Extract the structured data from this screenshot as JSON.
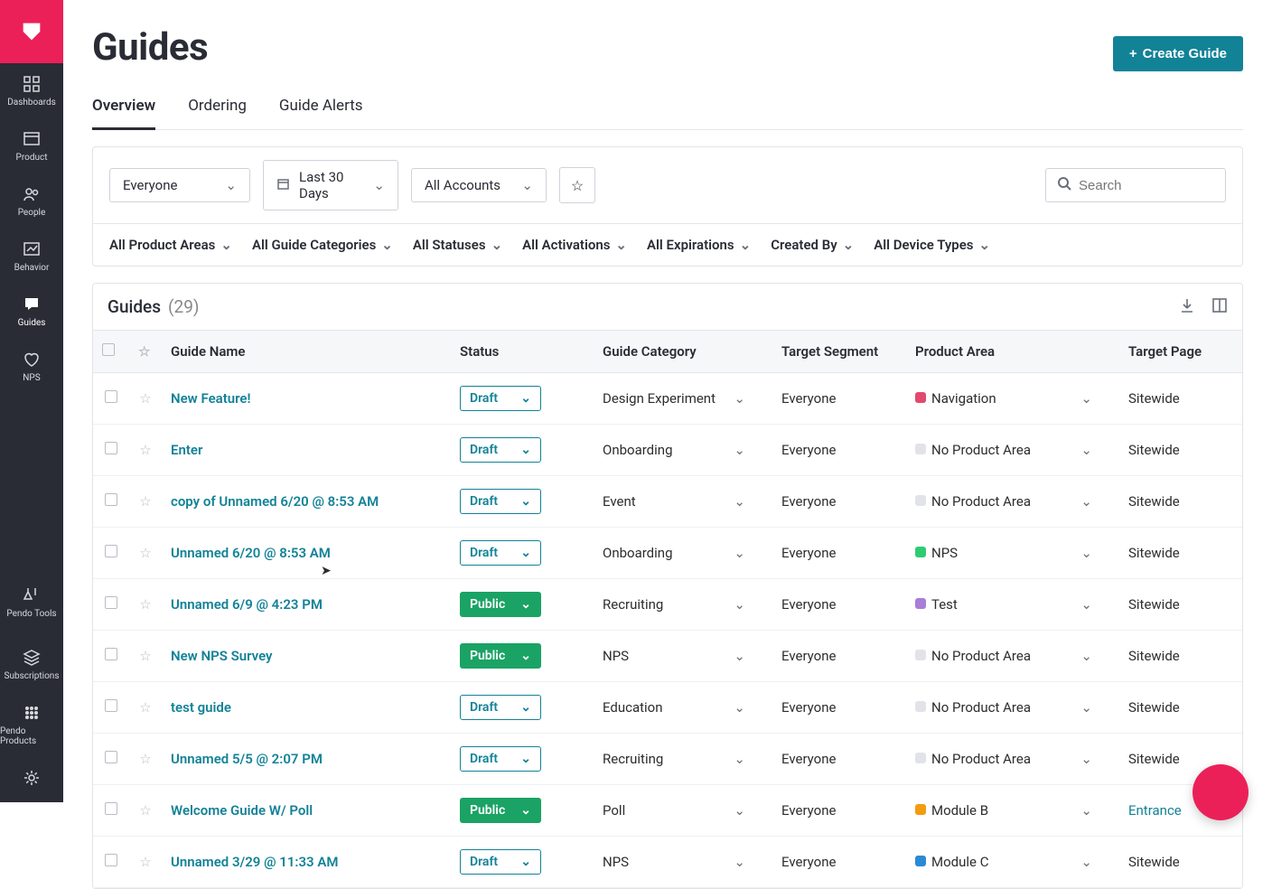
{
  "page_title": "Guides",
  "create_btn": "Create Guide",
  "tabs": [
    "Overview",
    "Ordering",
    "Guide Alerts"
  ],
  "active_tab": 0,
  "top_filters": {
    "segment": "Everyone",
    "date": "Last 30 Days",
    "accounts": "All Accounts",
    "search_placeholder": "Search"
  },
  "pill_filters": [
    "All Product Areas",
    "All Guide Categories",
    "All Statuses",
    "All Activations",
    "All Expirations",
    "Created By",
    "All Device Types"
  ],
  "table_title": "Guides",
  "table_count": "(29)",
  "columns": [
    "Guide Name",
    "Status",
    "Guide Category",
    "Target Segment",
    "Product Area",
    "Target Page"
  ],
  "sidebar": [
    "Dashboards",
    "Product",
    "People",
    "Behavior",
    "Guides",
    "NPS",
    "Pendo Tools",
    "Subscriptions",
    "Pendo Products"
  ],
  "product_area_colors": {
    "Navigation": "#e24a6d",
    "No Product Area": "#e1e3e8",
    "NPS": "#2ecc71",
    "Test": "#a97dd8",
    "Module B": "#f39c12",
    "Module C": "#2a8ad4"
  },
  "rows": [
    {
      "name": "New Feature!",
      "status": "Draft",
      "category": "Design Experiment",
      "segment": "Everyone",
      "product_area": "Navigation",
      "page": "Sitewide"
    },
    {
      "name": "Enter",
      "status": "Draft",
      "category": "Onboarding",
      "segment": "Everyone",
      "product_area": "No Product Area",
      "page": "Sitewide"
    },
    {
      "name": "copy of Unnamed 6/20 @ 8:53 AM",
      "status": "Draft",
      "category": "Event",
      "segment": "Everyone",
      "product_area": "No Product Area",
      "page": "Sitewide"
    },
    {
      "name": "Unnamed 6/20 @ 8:53 AM",
      "status": "Draft",
      "category": "Onboarding",
      "segment": "Everyone",
      "product_area": "NPS",
      "page": "Sitewide"
    },
    {
      "name": "Unnamed 6/9 @ 4:23 PM",
      "status": "Public",
      "category": "Recruiting",
      "segment": "Everyone",
      "product_area": "Test",
      "page": "Sitewide"
    },
    {
      "name": "New NPS Survey",
      "status": "Public",
      "category": "NPS",
      "segment": "Everyone",
      "product_area": "No Product Area",
      "page": "Sitewide"
    },
    {
      "name": "test guide",
      "status": "Draft",
      "category": "Education",
      "segment": "Everyone",
      "product_area": "No Product Area",
      "page": "Sitewide"
    },
    {
      "name": "Unnamed 5/5 @ 2:07 PM",
      "status": "Draft",
      "category": "Recruiting",
      "segment": "Everyone",
      "product_area": "No Product Area",
      "page": "Sitewide"
    },
    {
      "name": "Welcome Guide W/ Poll",
      "status": "Public",
      "category": "Poll",
      "segment": "Everyone",
      "product_area": "Module B",
      "page": "Entrance",
      "page_link": true
    },
    {
      "name": "Unnamed 3/29 @ 11:33 AM",
      "status": "Draft",
      "category": "NPS",
      "segment": "Everyone",
      "product_area": "Module C",
      "page": "Sitewide"
    }
  ]
}
